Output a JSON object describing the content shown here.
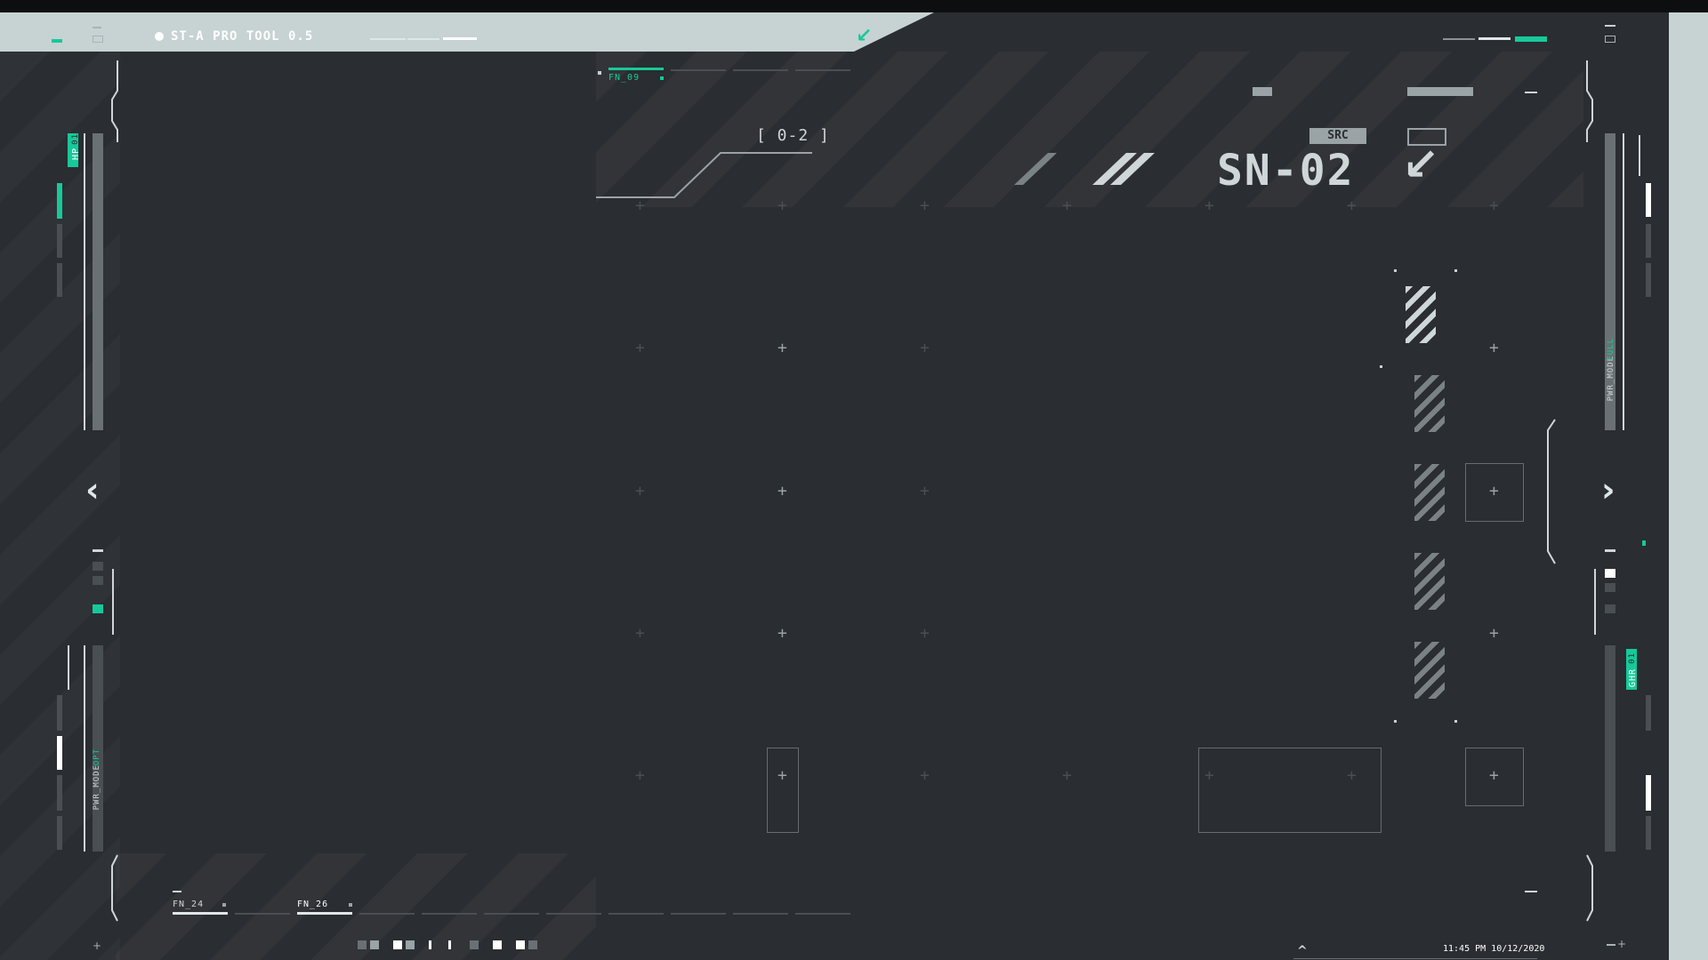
{
  "app": {
    "title": "ST-A PRO TOOL 0.5"
  },
  "header": {
    "fn_code": "FN_09",
    "range_label": "[ 0-2 ]",
    "src_badge": "SRC",
    "serial": "SN-02"
  },
  "left_panel": {
    "hp_label": "HP",
    "hp_value": "01",
    "pwr_label": "PWR_MODE",
    "pwr_value": "OPT"
  },
  "right_panel": {
    "pwr_label": "PWR_MODE",
    "pwr_value": "FULL",
    "ghr_label": "GHR",
    "ghr_value": "01"
  },
  "bottom": {
    "fn_a": "FN_24",
    "fn_b": "FN_26",
    "timestamp": "11:45 PM 10/12/2020"
  },
  "icons": {
    "corner_arrow": "arrow-down-left-icon",
    "nav_left": "chevron-left-icon",
    "nav_right": "chevron-right-icon",
    "collapse": "chevron-up-icon"
  },
  "colors": {
    "background": "#2a2d31",
    "accent": "#17c99a",
    "light": "#c7d2d3"
  }
}
